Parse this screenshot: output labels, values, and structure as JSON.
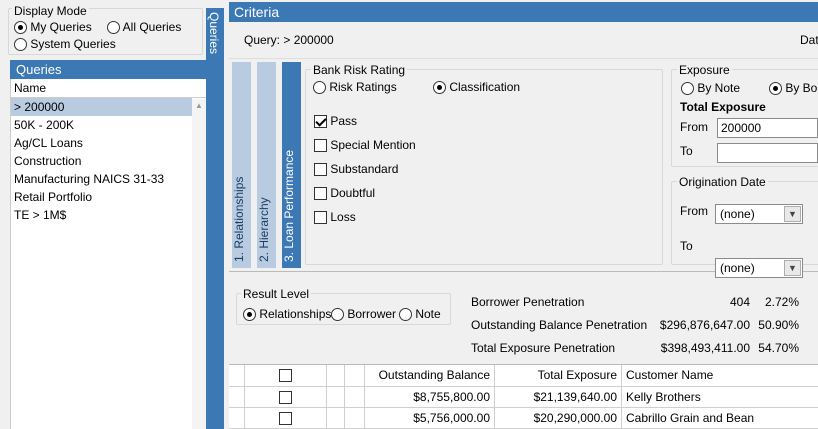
{
  "display_mode": {
    "legend": "Display Mode",
    "my_queries": "My Queries",
    "all_queries": "All Queries",
    "system_queries": "System Queries"
  },
  "queries_panel": {
    "title": "Queries",
    "col_name": "Name",
    "items": [
      "> 200000",
      "50K - 200K",
      "Ag/CL Loans",
      "Construction",
      "Manufacturing NAICS 31-33",
      "Retail Portfolio",
      "TE > 1M$"
    ]
  },
  "side_tab": {
    "label": "Queries"
  },
  "criteria": {
    "title": "Criteria",
    "query_label": "Query: > 200000",
    "right_cut": "Dat"
  },
  "tabs": [
    "1. Relationships",
    "2. Hierarchy",
    "3. Loan Performance"
  ],
  "bank_risk": {
    "legend": "Bank Risk Rating",
    "risk_ratings": "Risk Ratings",
    "classification": "Classification",
    "options": [
      "Pass",
      "Special Mention",
      "Substandard",
      "Doubtful",
      "Loss"
    ]
  },
  "exposure": {
    "legend": "Exposure",
    "by_note": "By Note",
    "by_borrower": "By Bor",
    "total_label": "Total Exposure",
    "from_label": "From",
    "from_value": "200000",
    "to_label": "To",
    "to_value": ""
  },
  "origination": {
    "legend": "Origination Date",
    "from_label": "From",
    "from_value": "(none)",
    "to_label": "To",
    "to_value": "(none)"
  },
  "result_level": {
    "legend": "Result Level",
    "relationships": "Relationships",
    "borrower": "Borrower",
    "note": "Note"
  },
  "penetration": [
    {
      "label": "Borrower Penetration",
      "value": "404",
      "pct": "2.72%"
    },
    {
      "label": "Outstanding Balance Penetration",
      "value": "$296,876,647.00",
      "pct": "50.90%"
    },
    {
      "label": "Total Exposure Penetration",
      "value": "$398,493,411.00",
      "pct": "54.70%"
    }
  ],
  "grid": {
    "headers": {
      "outstanding": "Outstanding Balance",
      "exposure": "Total Exposure",
      "customer": "Customer Name"
    },
    "rows": [
      {
        "outstanding": "$8,755,800.00",
        "exposure": "$21,139,640.00",
        "customer": "Kelly Brothers"
      },
      {
        "outstanding": "$5,756,000.00",
        "exposure": "$20,290,000.00",
        "customer": "Cabrillo Grain and Bean"
      }
    ]
  }
}
